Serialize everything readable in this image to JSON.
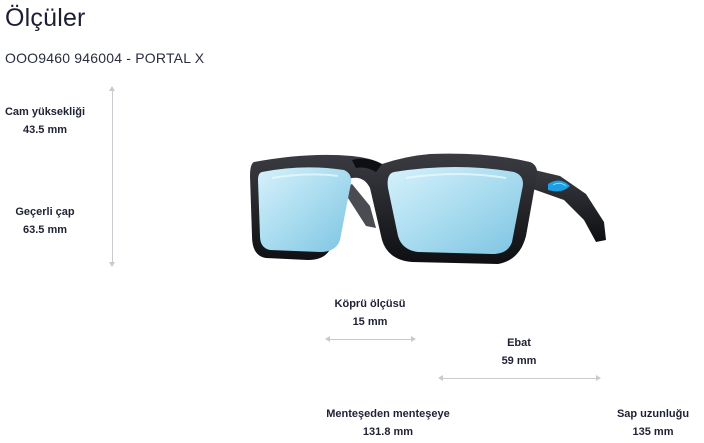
{
  "page": {
    "title": "Ölçüler",
    "product": "OOO9460 946004 - PORTAL X"
  },
  "measurements": {
    "lens_height": {
      "label": "Cam yüksekliği",
      "value": "43.5 mm"
    },
    "effective_diameter": {
      "label": "Geçerli çap",
      "value": "63.5 mm"
    },
    "bridge": {
      "label": "Köprü ölçüsü",
      "value": "15 mm"
    },
    "lens_width": {
      "label": "Ebat",
      "value": "59 mm"
    },
    "hinge_to_hinge": {
      "label": "Menteşeden menteşeye",
      "value": "131.8 mm"
    },
    "temple_length": {
      "label": "Sap uzunluğu",
      "value": "135 mm"
    }
  },
  "colors": {
    "text": "#1f2233",
    "dimension_line": "#c9c9cf",
    "frame": "#1a1b1f",
    "lens": "#a9dcef",
    "temple_accent": "#1c9fe0"
  },
  "icons": {
    "product_image": "sunglasses-image"
  }
}
